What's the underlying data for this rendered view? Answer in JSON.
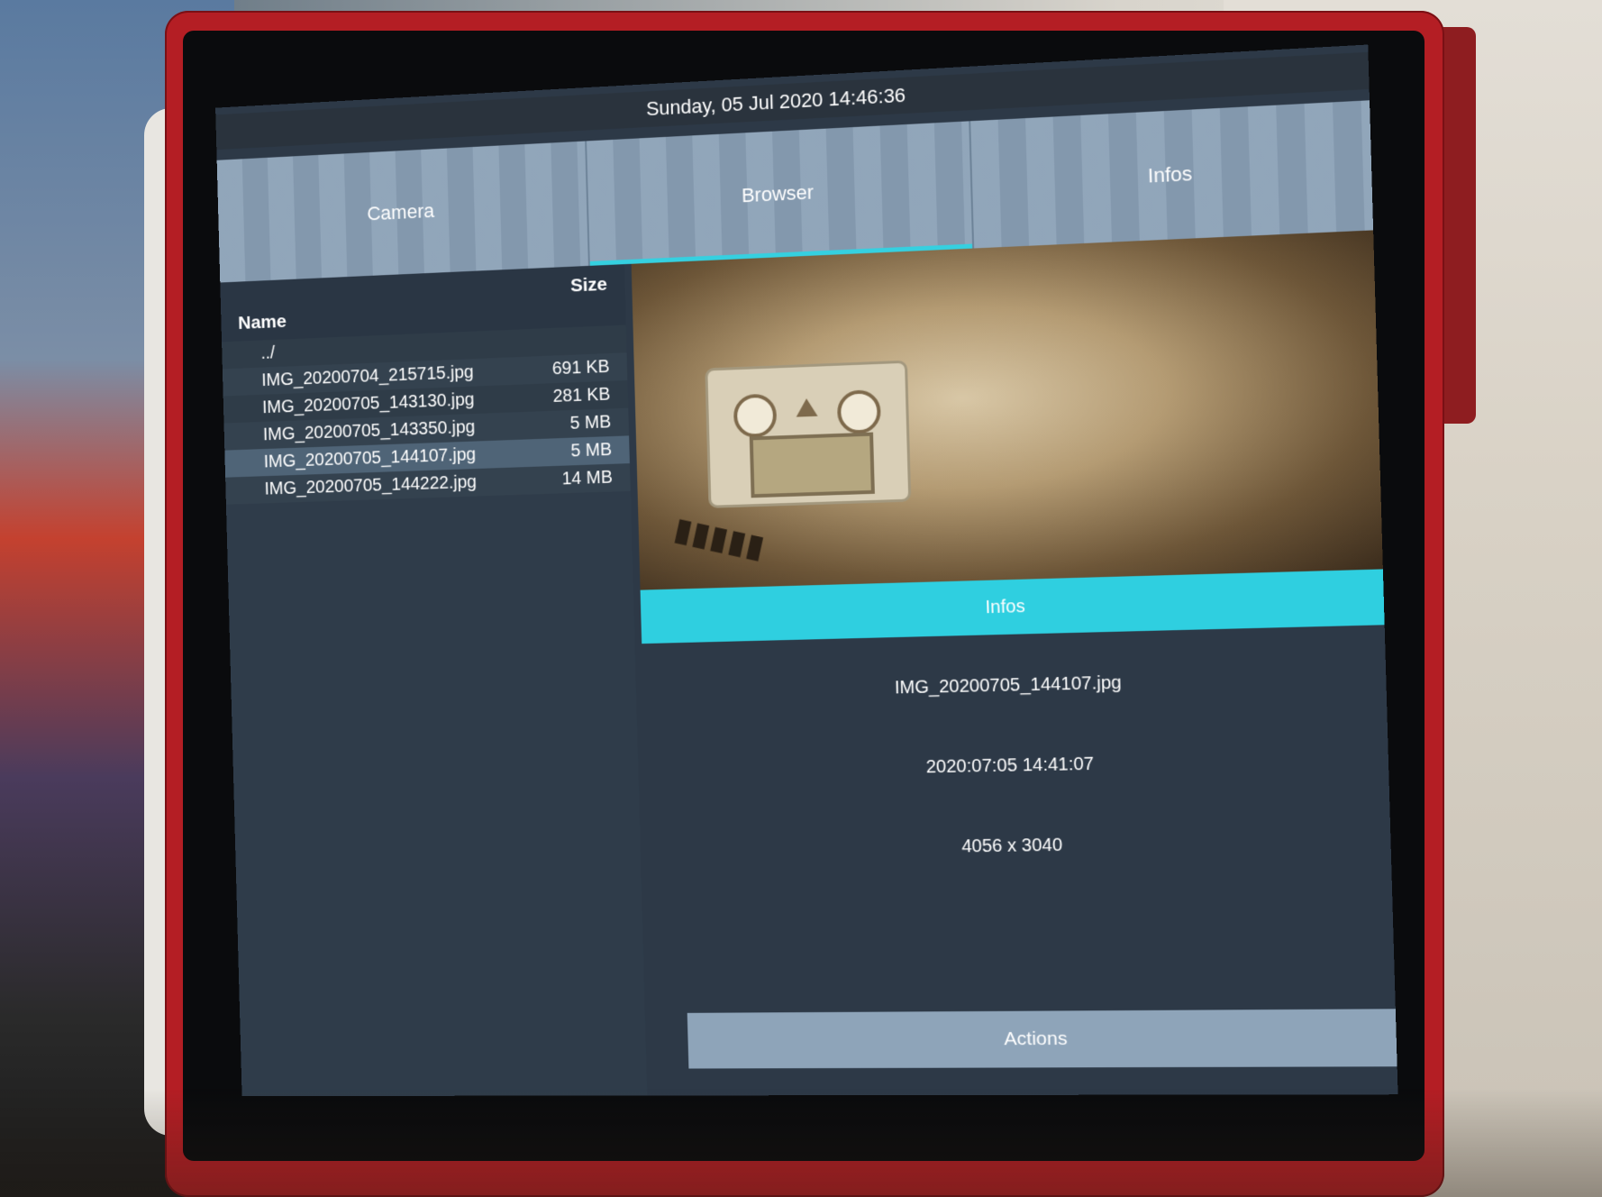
{
  "status": {
    "datetime": "Sunday, 05 Jul 2020 14:46:36"
  },
  "tabs": [
    {
      "label": "Camera",
      "active": false
    },
    {
      "label": "Browser",
      "active": true
    },
    {
      "label": "Infos",
      "active": false
    }
  ],
  "file_browser": {
    "columns": {
      "name": "Name",
      "size": "Size"
    },
    "rows": [
      {
        "name": "../",
        "size": ""
      },
      {
        "name": "IMG_20200704_215715.jpg",
        "size": "691 KB"
      },
      {
        "name": "IMG_20200705_143130.jpg",
        "size": "281 KB"
      },
      {
        "name": "IMG_20200705_143350.jpg",
        "size": "5 MB"
      },
      {
        "name": "IMG_20200705_144107.jpg",
        "size": "5 MB",
        "selected": true
      },
      {
        "name": "IMG_20200705_144222.jpg",
        "size": "14 MB"
      }
    ]
  },
  "details": {
    "infos_label": "Infos",
    "filename": "IMG_20200705_144107.jpg",
    "date": "2020:07:05 14:41:07",
    "resolution": "4056 x 3040",
    "actions_label": "Actions"
  },
  "colors": {
    "accent": "#35d0e0",
    "tab_bg": "#8aa0b6",
    "screen_bg": "#2d3947",
    "device_red": "#b41e24"
  }
}
